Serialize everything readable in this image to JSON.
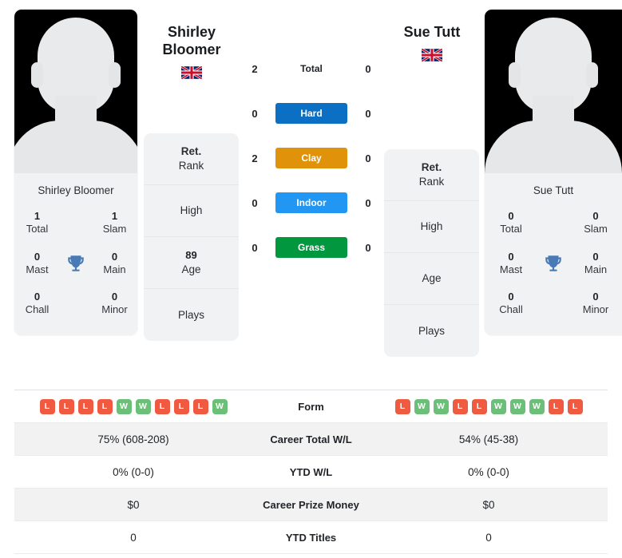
{
  "players": {
    "left": {
      "name": "Shirley Bloomer",
      "name_line1": "Shirley",
      "name_line2": "Bloomer",
      "flag": "gb-flag-icon",
      "avatar": "player-avatar-placeholder",
      "titles": [
        {
          "num": "1",
          "label": "Total"
        },
        {
          "num": "1",
          "label": "Slam"
        },
        {
          "num": "0",
          "label": "Mast"
        },
        {
          "num": "0",
          "label": "Main"
        },
        {
          "num": "0",
          "label": "Chall"
        },
        {
          "num": "0",
          "label": "Minor"
        }
      ],
      "info": [
        {
          "num": "Ret.",
          "label": "Rank",
          "num_bold": true
        },
        {
          "num": "",
          "label": "High"
        },
        {
          "num": "89",
          "label": "Age"
        },
        {
          "num": "",
          "label": "Plays"
        }
      ]
    },
    "right": {
      "name": "Sue Tutt",
      "name_line1": "Sue Tutt",
      "name_line2": "",
      "flag": "gb-flag-icon",
      "avatar": "player-avatar-placeholder",
      "titles": [
        {
          "num": "0",
          "label": "Total"
        },
        {
          "num": "0",
          "label": "Slam"
        },
        {
          "num": "0",
          "label": "Mast"
        },
        {
          "num": "0",
          "label": "Main"
        },
        {
          "num": "0",
          "label": "Chall"
        },
        {
          "num": "0",
          "label": "Minor"
        }
      ],
      "info": [
        {
          "num": "Ret.",
          "label": "Rank",
          "num_bold": true
        },
        {
          "num": "",
          "label": "High"
        },
        {
          "num": "",
          "label": "Age"
        },
        {
          "num": "",
          "label": "Plays"
        }
      ]
    }
  },
  "trophy_icon": "trophy-icon",
  "surface_comparison": [
    {
      "label": "Total",
      "left": "2",
      "right": "0",
      "style": "plain",
      "color": ""
    },
    {
      "label": "Hard",
      "left": "0",
      "right": "0",
      "style": "chip",
      "color": "#0b6fc4"
    },
    {
      "label": "Clay",
      "left": "2",
      "right": "0",
      "style": "chip",
      "color": "#e0930a"
    },
    {
      "label": "Indoor",
      "left": "0",
      "right": "0",
      "style": "chip",
      "color": "#2196f3"
    },
    {
      "label": "Grass",
      "left": "0",
      "right": "0",
      "style": "chip",
      "color": "#00973f"
    }
  ],
  "stats_table": {
    "form_label": "Form",
    "left_form": [
      "L",
      "L",
      "L",
      "L",
      "W",
      "W",
      "L",
      "L",
      "L",
      "W"
    ],
    "right_form": [
      "L",
      "W",
      "W",
      "L",
      "L",
      "W",
      "W",
      "W",
      "L",
      "L"
    ],
    "win_color": "#6cbf78",
    "loss_color": "#f05a40",
    "rows": [
      {
        "label": "Career Total W/L",
        "left": "75% (608-208)",
        "right": "54% (45-38)"
      },
      {
        "label": "YTD W/L",
        "left": "0% (0-0)",
        "right": "0% (0-0)"
      },
      {
        "label": "Career Prize Money",
        "left": "$0",
        "right": "$0"
      },
      {
        "label": "YTD Titles",
        "left": "0",
        "right": "0"
      }
    ]
  }
}
